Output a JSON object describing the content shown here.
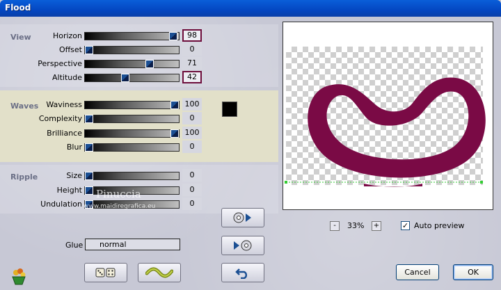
{
  "window": {
    "title": "Flood"
  },
  "sections": {
    "view": {
      "label": "View",
      "params": [
        {
          "label": "Horizon",
          "value": "98",
          "level": 0.98,
          "highlight": true
        },
        {
          "label": "Offset",
          "value": "0",
          "level": 0.0,
          "highlight": false
        },
        {
          "label": "Perspective",
          "value": "71",
          "level": 0.71,
          "highlight": false
        },
        {
          "label": "Altitude",
          "value": "42",
          "level": 0.42,
          "highlight": true
        }
      ]
    },
    "waves": {
      "label": "Waves",
      "params": [
        {
          "label": "Waviness",
          "value": "100",
          "level": 1.0
        },
        {
          "label": "Complexity",
          "value": "0",
          "level": 0.0
        },
        {
          "label": "Brilliance",
          "value": "100",
          "level": 1.0
        },
        {
          "label": "Blur",
          "value": "0",
          "level": 0.0
        }
      ],
      "color": "#000000"
    },
    "ripple": {
      "label": "Ripple",
      "params": [
        {
          "label": "Size",
          "value": "0",
          "level": 0.0
        },
        {
          "label": "Height",
          "value": "0",
          "level": 0.0
        },
        {
          "label": "Undulation",
          "value": "0",
          "level": 0.0
        }
      ]
    }
  },
  "glue": {
    "label": "Glue",
    "value": "normal"
  },
  "watermark": {
    "line1": "Pinuccia",
    "line2": "www.maidiregrafica.eu"
  },
  "preview": {
    "zoom": "33%",
    "auto_preview_label": "Auto preview",
    "auto_preview_checked": true,
    "shape_color": "#7a0a45"
  },
  "buttons": {
    "cancel": "Cancel",
    "ok": "OK"
  },
  "icons": {
    "dice": "dice-icon",
    "wave": "wave-icon",
    "play_forward": "forward-preview-icon",
    "play_back": "back-preview-icon",
    "undo": "undo-icon",
    "logo": "flower-pot-icon"
  }
}
